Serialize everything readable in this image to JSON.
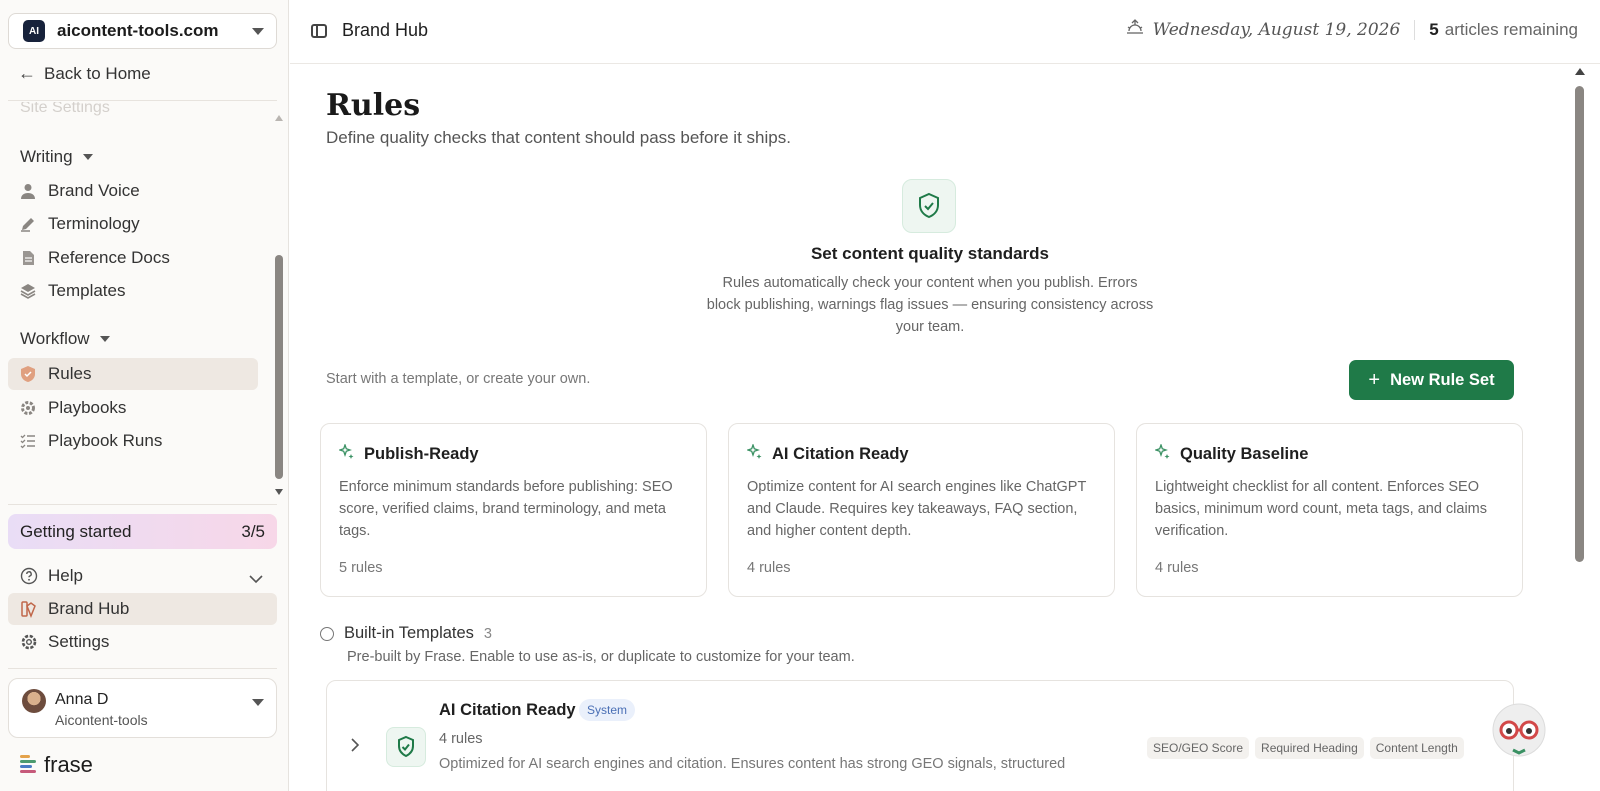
{
  "sidebar": {
    "site_name": "aicontent-tools.com",
    "back_label": "Back to Home",
    "faded_item": "Site Settings",
    "writing_label": "Writing",
    "writing_items": [
      {
        "label": "Brand Voice",
        "icon": "person-icon"
      },
      {
        "label": "Terminology",
        "icon": "pen-icon"
      },
      {
        "label": "Reference Docs",
        "icon": "document-icon"
      },
      {
        "label": "Templates",
        "icon": "layers-icon"
      }
    ],
    "workflow_label": "Workflow",
    "workflow_items": [
      {
        "label": "Rules",
        "icon": "shield-icon",
        "active": true
      },
      {
        "label": "Playbooks",
        "icon": "gear-icon"
      },
      {
        "label": "Playbook Runs",
        "icon": "checklist-icon"
      }
    ],
    "getting_started": {
      "label": "Getting started",
      "progress": "3/5"
    },
    "bottom_items": [
      {
        "label": "Help",
        "icon": "help-icon"
      },
      {
        "label": "Brand Hub",
        "icon": "brand-hub-icon",
        "active": true
      },
      {
        "label": "Settings",
        "icon": "settings-icon"
      }
    ],
    "user": {
      "name": "Anna D",
      "org": "Aicontent-tools"
    },
    "logo_text": "frase"
  },
  "topbar": {
    "title": "Brand Hub",
    "date": "Wednesday, August 19, 2026",
    "articles_count": "5",
    "articles_label": "articles remaining"
  },
  "main": {
    "title": "Rules",
    "subtitle": "Define quality checks that content should pass before it ships.",
    "hero_title": "Set content quality standards",
    "hero_desc": "Rules automatically check your content when you publish. Errors block publishing, warnings flag issues — ensuring consistency across your team.",
    "start_text": "Start with a template, or create your own.",
    "new_rule_label": "New Rule Set",
    "templates": [
      {
        "name": "Publish-Ready",
        "desc": "Enforce minimum standards before publishing: SEO score, verified claims, brand terminology, and meta tags.",
        "count": "5 rules"
      },
      {
        "name": "AI Citation Ready",
        "desc": "Optimize content for AI search engines like ChatGPT and Claude. Requires key takeaways, FAQ section, and higher content depth.",
        "count": "4 rules"
      },
      {
        "name": "Quality Baseline",
        "desc": "Lightweight checklist for all content. Enforces SEO basics, minimum word count, meta tags, and claims verification.",
        "count": "4 rules"
      }
    ],
    "builtin": {
      "title": "Built-in Templates",
      "count": "3",
      "subtitle": "Pre-built by Frase. Enable to use as-is, or duplicate to customize for your team."
    },
    "rule_row": {
      "title": "AI Citation Ready",
      "badge": "System",
      "count": "4 rules",
      "desc": "Optimized for AI search engines and citation. Ensures content has strong GEO signals, structured",
      "tags": [
        "SEO/GEO Score",
        "Required Heading",
        "Content Length"
      ]
    }
  },
  "colors": {
    "accent_green": "#1f7a48",
    "active_bg": "#eee8e2",
    "badge_blue": "#4a6fb5"
  }
}
